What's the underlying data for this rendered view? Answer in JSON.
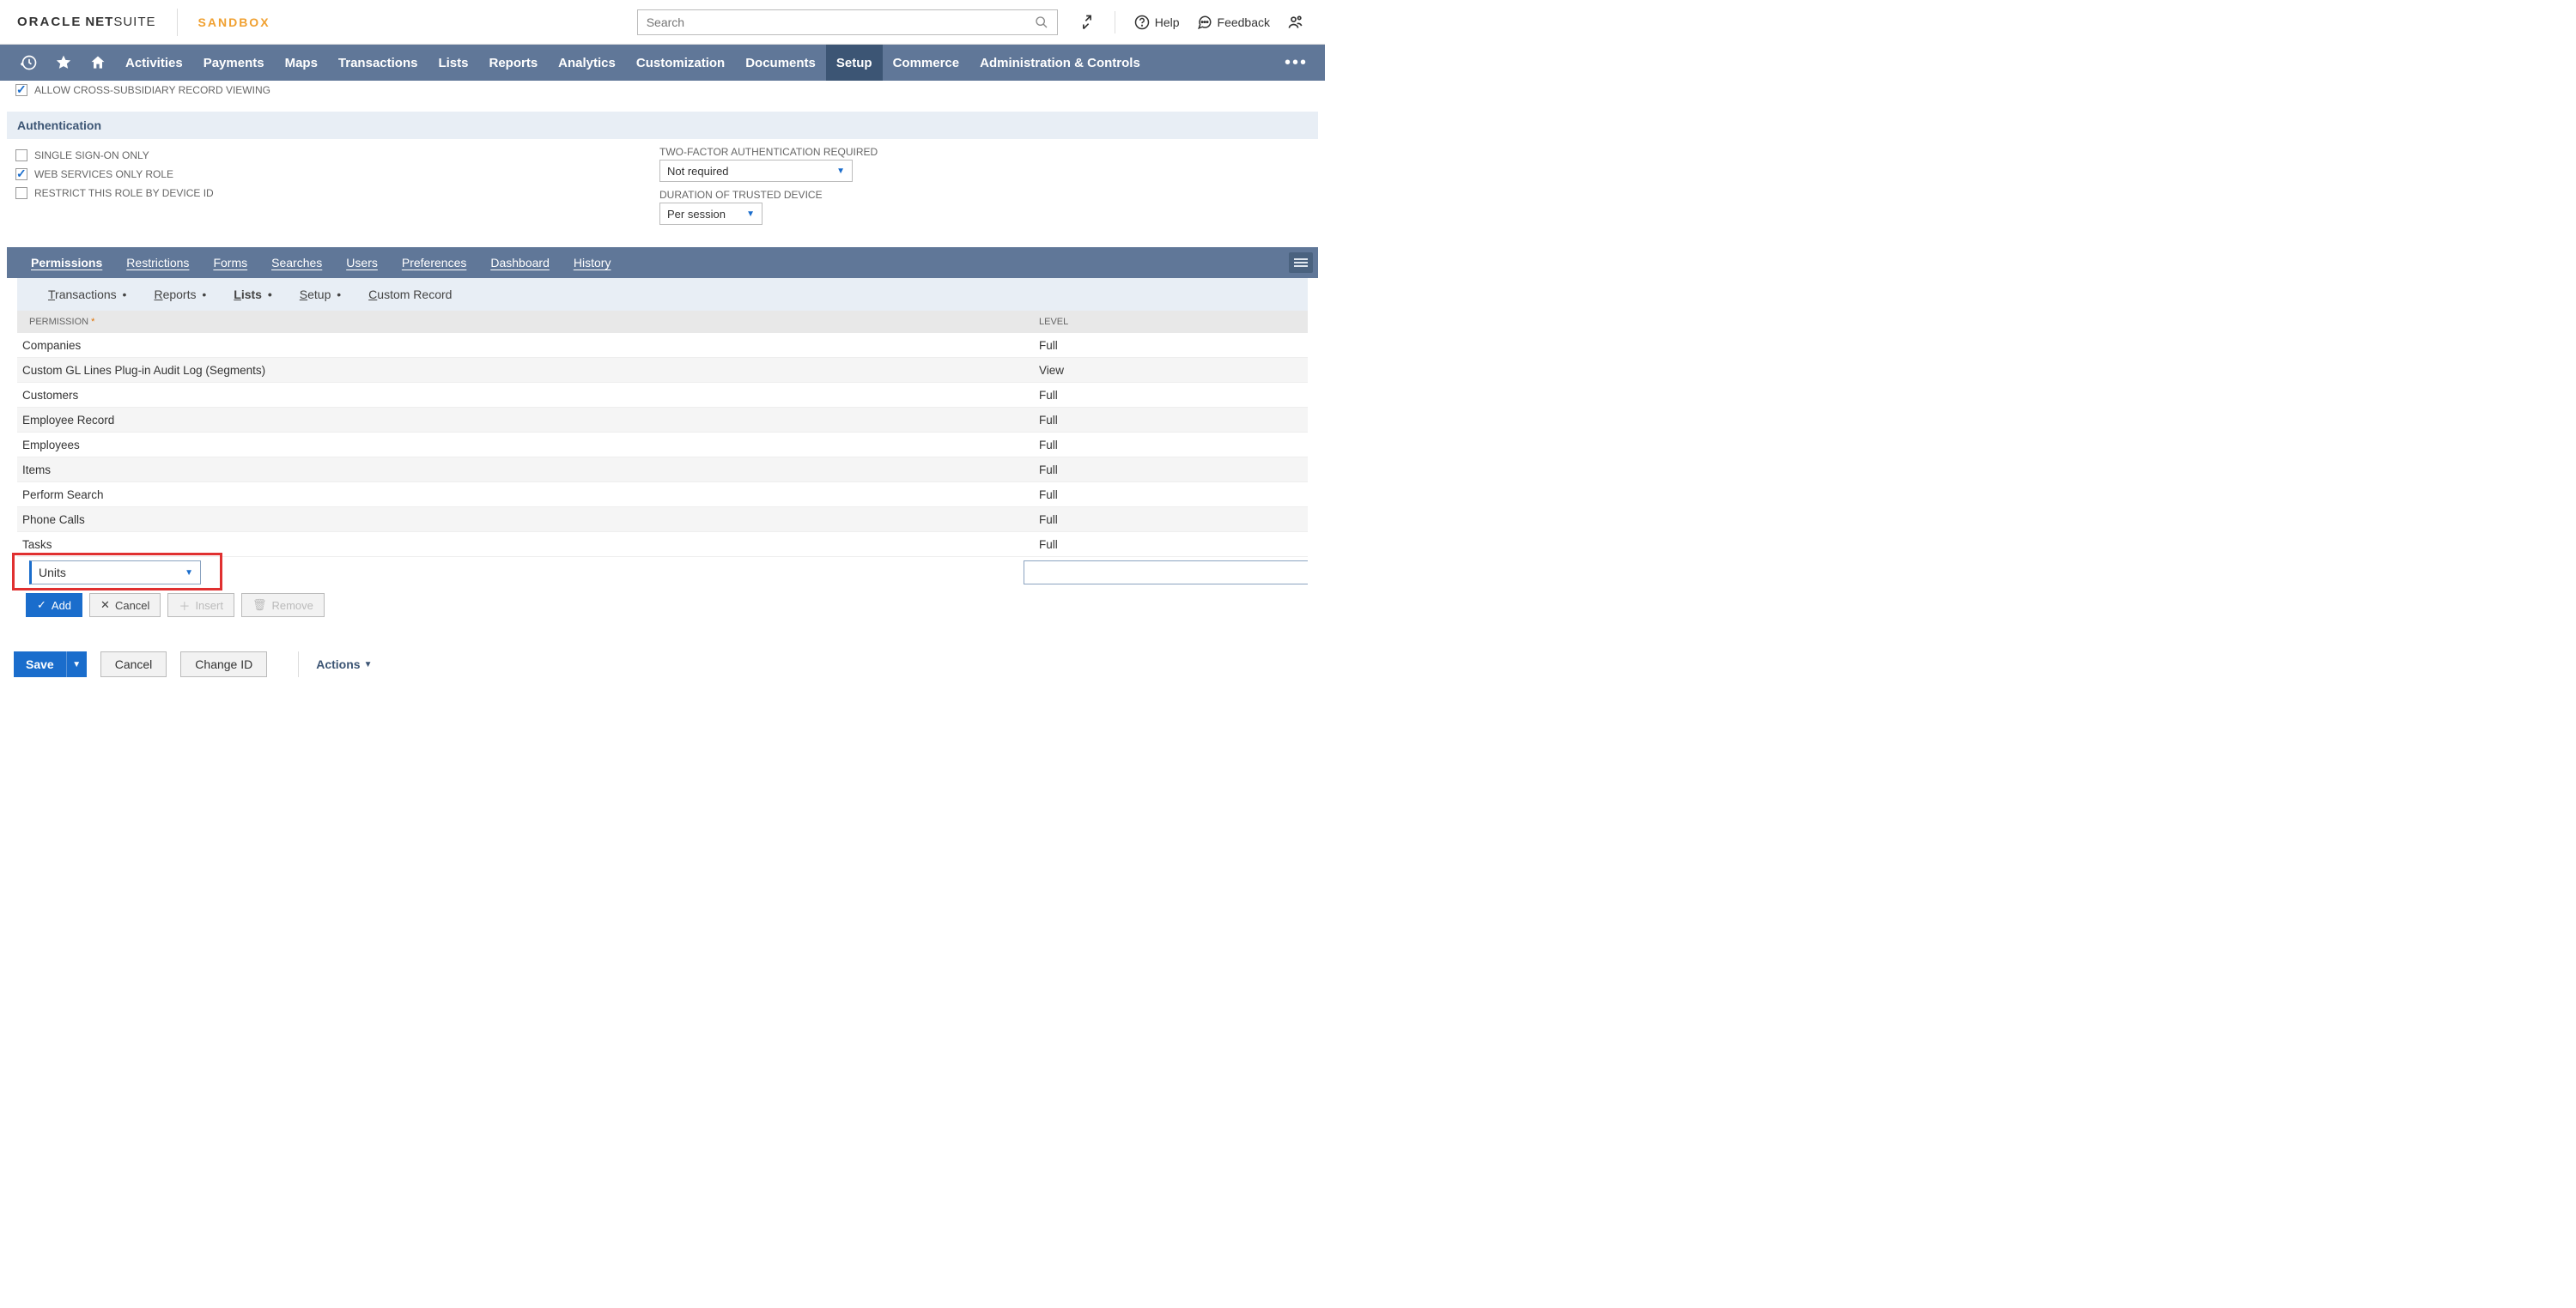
{
  "header": {
    "logo_oracle": "ORACLE",
    "logo_net": "NET",
    "logo_suite": "SUITE",
    "sandbox": "SANDBOX",
    "search_placeholder": "Search",
    "help": "Help",
    "feedback": "Feedback"
  },
  "main_nav": [
    "Activities",
    "Payments",
    "Maps",
    "Transactions",
    "Lists",
    "Reports",
    "Analytics",
    "Customization",
    "Documents",
    "Setup",
    "Commerce",
    "Administration & Controls"
  ],
  "main_nav_active": "Setup",
  "cross_sub_label": "ALLOW CROSS-SUBSIDIARY RECORD VIEWING",
  "auth_section": "Authentication",
  "auth_left": [
    {
      "label": "SINGLE SIGN-ON ONLY",
      "checked": false
    },
    {
      "label": "WEB SERVICES ONLY ROLE",
      "checked": true
    },
    {
      "label": "RESTRICT THIS ROLE BY DEVICE ID",
      "checked": false
    }
  ],
  "auth_right": {
    "tfa_label": "TWO-FACTOR AUTHENTICATION REQUIRED",
    "tfa_value": "Not required",
    "duration_label": "DURATION OF TRUSTED DEVICE",
    "duration_value": "Per session"
  },
  "subtabs": [
    "Permissions",
    "Restrictions",
    "Forms",
    "Searches",
    "Users",
    "Preferences",
    "Dashboard",
    "History"
  ],
  "subtabs_underline_idx": [
    0,
    0,
    0,
    0,
    0,
    2,
    0,
    0
  ],
  "subtabs_active": "Permissions",
  "subsubtabs": [
    {
      "label": "Transactions",
      "dot": true,
      "ul": 0
    },
    {
      "label": "Reports",
      "dot": true,
      "ul": 0
    },
    {
      "label": "Lists",
      "dot": true,
      "ul": 0
    },
    {
      "label": "Setup",
      "dot": true,
      "ul": 0
    },
    {
      "label": "Custom Record",
      "dot": false,
      "ul": 0
    }
  ],
  "subsub_active": "Lists",
  "table_head": {
    "c1": "PERMISSION",
    "c2": "LEVEL"
  },
  "rows": [
    {
      "p": "Companies",
      "l": "Full"
    },
    {
      "p": "Custom GL Lines Plug-in Audit Log (Segments)",
      "l": "View"
    },
    {
      "p": "Customers",
      "l": "Full"
    },
    {
      "p": "Employee Record",
      "l": "Full"
    },
    {
      "p": "Employees",
      "l": "Full"
    },
    {
      "p": "Items",
      "l": "Full"
    },
    {
      "p": "Perform Search",
      "l": "Full"
    },
    {
      "p": "Phone Calls",
      "l": "Full"
    },
    {
      "p": "Tasks",
      "l": "Full"
    }
  ],
  "edit_value": "Units",
  "row_buttons": {
    "add": "Add",
    "cancel": "Cancel",
    "insert": "Insert",
    "remove": "Remove"
  },
  "bottom": {
    "save": "Save",
    "cancel": "Cancel",
    "change_id": "Change ID",
    "actions": "Actions"
  }
}
